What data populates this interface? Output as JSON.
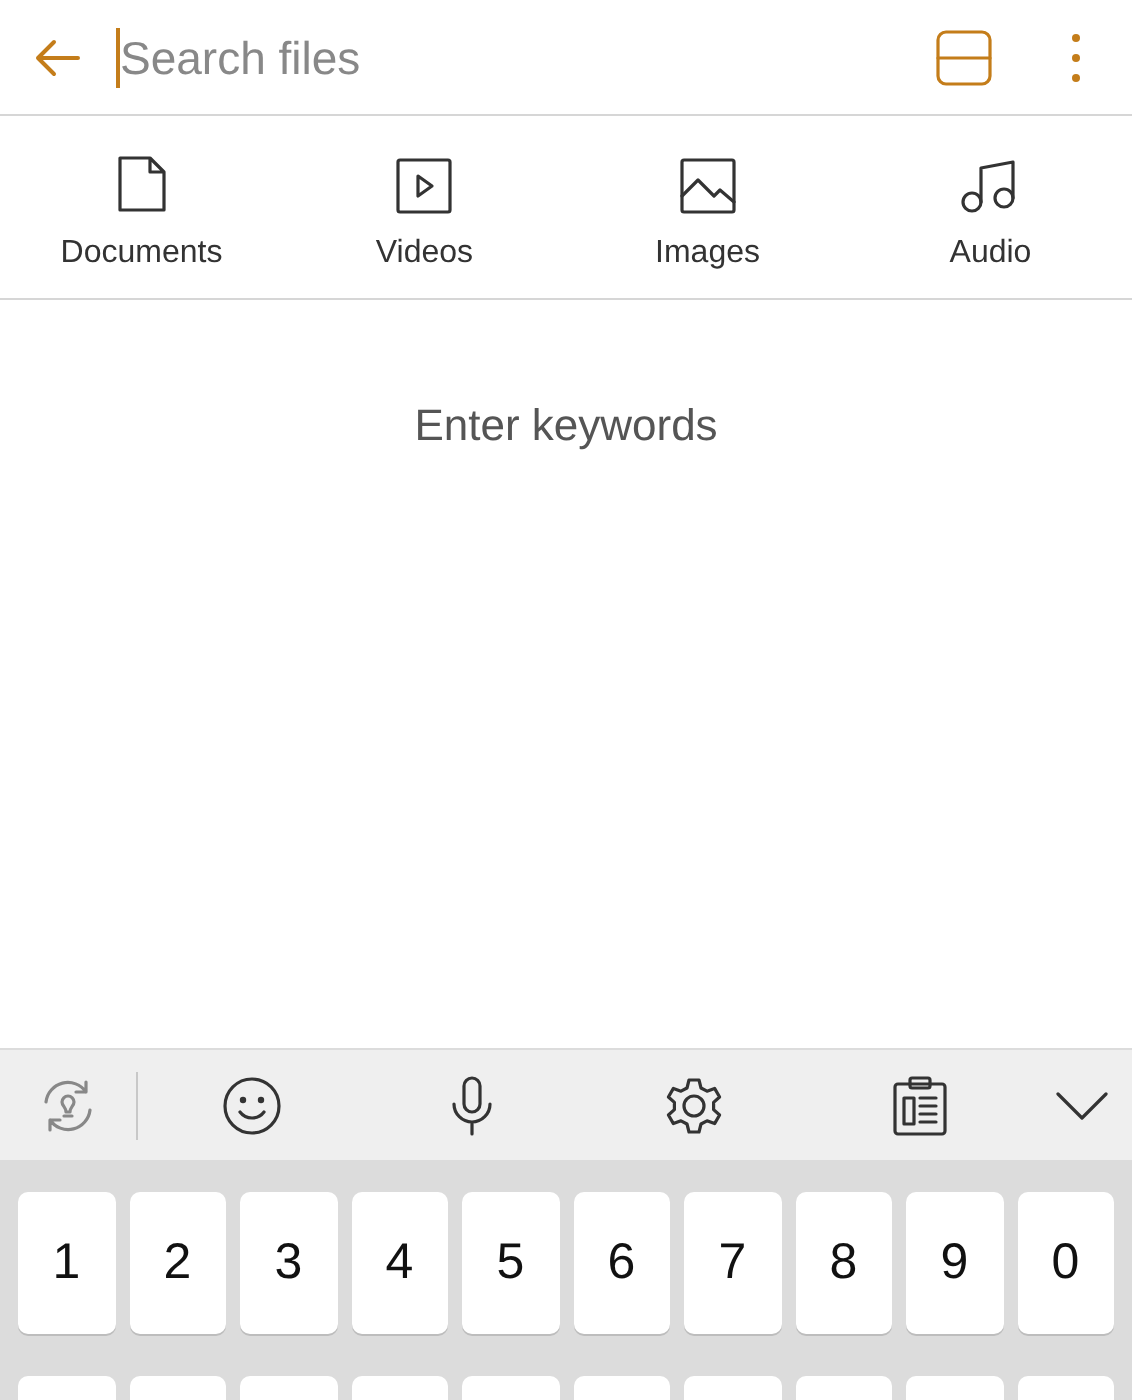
{
  "search": {
    "placeholder": "Search files"
  },
  "categories": [
    {
      "kind": "document",
      "label": "Documents"
    },
    {
      "kind": "video",
      "label": "Videos"
    },
    {
      "kind": "image",
      "label": "Images"
    },
    {
      "kind": "audio",
      "label": "Audio"
    }
  ],
  "empty_message": "Enter keywords",
  "keyboard": {
    "number_keys": [
      "1",
      "2",
      "3",
      "4",
      "5",
      "6",
      "7",
      "8",
      "9",
      "0"
    ]
  }
}
